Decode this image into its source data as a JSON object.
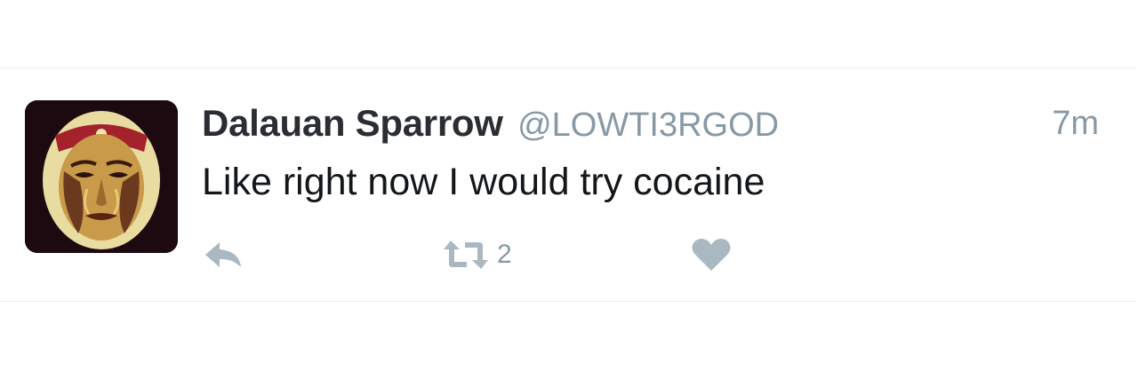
{
  "tweet": {
    "author_name": "Dalauan Sparrow",
    "author_handle": "@LOWTI3RGOD",
    "timestamp": "7m",
    "text": "Like right now I would try cocaine"
  },
  "actions": {
    "reply_icon": "reply-arrow-icon",
    "retweet_icon": "retweet-icon",
    "retweet_count": "2",
    "like_icon": "heart-icon"
  },
  "colors": {
    "name": "#2a2e33",
    "secondary": "#8899a6",
    "text": "#14171a",
    "icons": "#aab8c2"
  }
}
